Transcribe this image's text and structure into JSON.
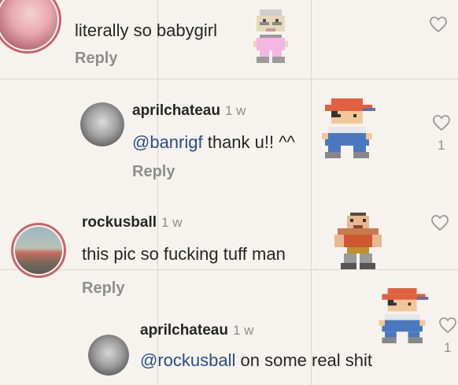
{
  "comments": [
    {
      "text": "literally so babygirl",
      "reply_label": "Reply"
    },
    {
      "username": "aprilchateau",
      "time": "1 w",
      "mention": "@banrigf",
      "text": " thank u!! ^^",
      "reply_label": "Reply",
      "likes": "1"
    },
    {
      "username": "rockusball",
      "time": "1 w",
      "text": "this pic so fucking tuff man",
      "reply_label": "Reply"
    },
    {
      "username": "aprilchateau",
      "time": "1 w",
      "mention": "@rockusball",
      "text": " on some real shit",
      "likes": "1"
    }
  ],
  "icons": {
    "heart": "heart-outline-icon",
    "sprites": [
      "pixel-character-pink",
      "pixel-character-red-cap",
      "pixel-character-muscle",
      "pixel-character-red-cap-2"
    ]
  },
  "colors": {
    "text": "#262626",
    "muted": "#8e8e8e",
    "mention": "#2b4d85",
    "story_ring": "#c8646e"
  }
}
